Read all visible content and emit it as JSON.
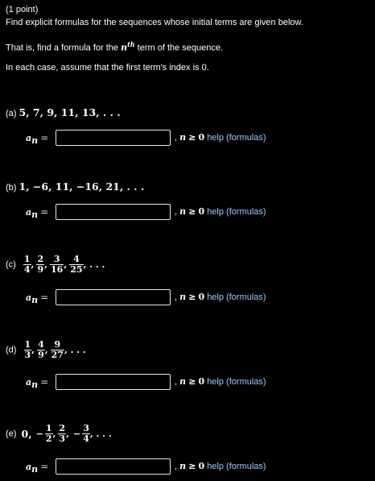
{
  "header": {
    "points": "(1 point)",
    "instruction1": "Find explicit formulas for the sequences whose initial terms are given below.",
    "instruction2_pre": "That is, find a formula for the",
    "instruction2_n": "n",
    "instruction2_th": "th",
    "instruction2_post": "term of the sequence.",
    "instruction3": "In each case, assume that the first term's index is 0."
  },
  "common": {
    "an_label": "a",
    "an_sub": "n",
    "equals": "=",
    "cond_comma": ",",
    "cond_n": "n",
    "cond_ge": "≥",
    "cond_zero": "0",
    "help_label": "help (formulas)",
    "ellipsis": ", . . ."
  },
  "parts": {
    "a": {
      "label": "(a)",
      "sequence": "5, 7, 9, 11, 13, . . .",
      "answer": ""
    },
    "b": {
      "label": "(b)",
      "sequence": "1, −6, 11, −16, 21, . . .",
      "answer": ""
    },
    "c": {
      "label": "(c)",
      "fractions": [
        {
          "n": "1",
          "d": "4"
        },
        {
          "n": "2",
          "d": "9"
        },
        {
          "n": "3",
          "d": "16"
        },
        {
          "n": "4",
          "d": "25"
        }
      ],
      "answer": ""
    },
    "d": {
      "label": "(d)",
      "fractions": [
        {
          "n": "1",
          "d": "3"
        },
        {
          "n": "4",
          "d": "9"
        },
        {
          "n": "9",
          "d": "27"
        }
      ],
      "answer": ""
    },
    "e": {
      "label": "(e)",
      "first": "0,",
      "minus": "−",
      "fractions": [
        {
          "n": "1",
          "d": "2"
        },
        {
          "n": "2",
          "d": "3"
        },
        {
          "n": "3",
          "d": "4"
        }
      ],
      "answer": ""
    }
  }
}
